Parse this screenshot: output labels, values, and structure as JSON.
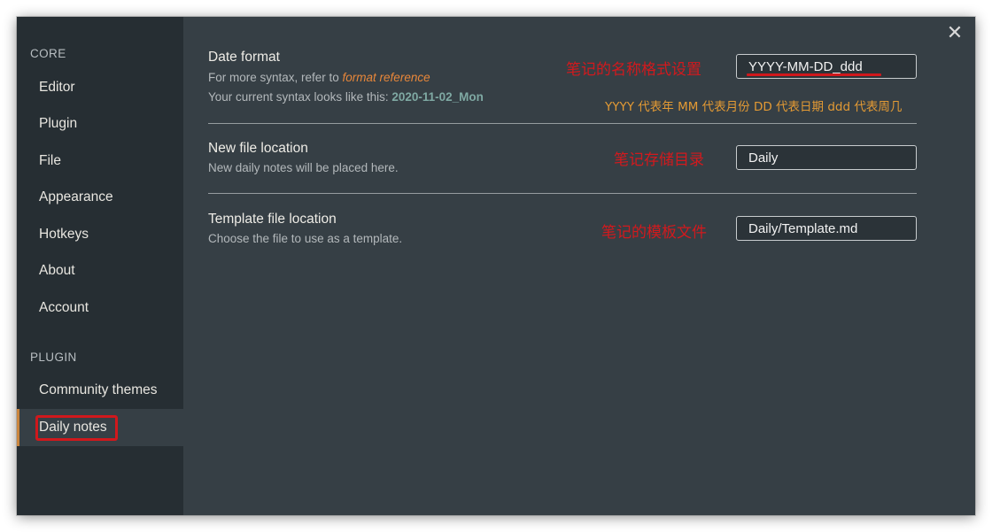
{
  "sidebar": {
    "core_heading": "CORE",
    "core_items": [
      {
        "label": "Editor"
      },
      {
        "label": "Plugin"
      },
      {
        "label": "File"
      },
      {
        "label": "Appearance"
      },
      {
        "label": "Hotkeys"
      },
      {
        "label": "About"
      },
      {
        "label": "Account"
      }
    ],
    "plugin_heading": "PLUGIN",
    "plugin_items": [
      {
        "label": "Community themes"
      },
      {
        "label": "Daily notes",
        "active": true
      }
    ]
  },
  "close_icon_glyph": "✕",
  "settings": [
    {
      "name": "Date format",
      "desc_prefix": "For more syntax, refer to ",
      "desc_link": "format reference",
      "desc2_prefix": "Your current syntax looks like this: ",
      "desc2_sample": "2020-11-02_Mon",
      "value": "YYYY-MM-DD_ddd"
    },
    {
      "name": "New file location",
      "desc": "New daily notes will be placed here.",
      "value": "Daily"
    },
    {
      "name": "Template file location",
      "desc": "Choose the file to use as a template.",
      "value": "Daily/Template.md"
    }
  ],
  "annotations": {
    "date_format": "笔记的名称格式设置",
    "date_format_note": "YYYY 代表年 MM 代表月份 DD 代表日期 ddd 代表周几",
    "file_location": "笔记存储目录",
    "template": "笔记的模板文件"
  },
  "colors": {
    "window_bg": "#363f45",
    "sidebar_bg": "#262e33",
    "accent_active": "#c9853e",
    "link": "#e8873a",
    "sample": "#7fa9a3",
    "annotation_red": "#d3191d",
    "annotation_orange": "#e39a34"
  }
}
